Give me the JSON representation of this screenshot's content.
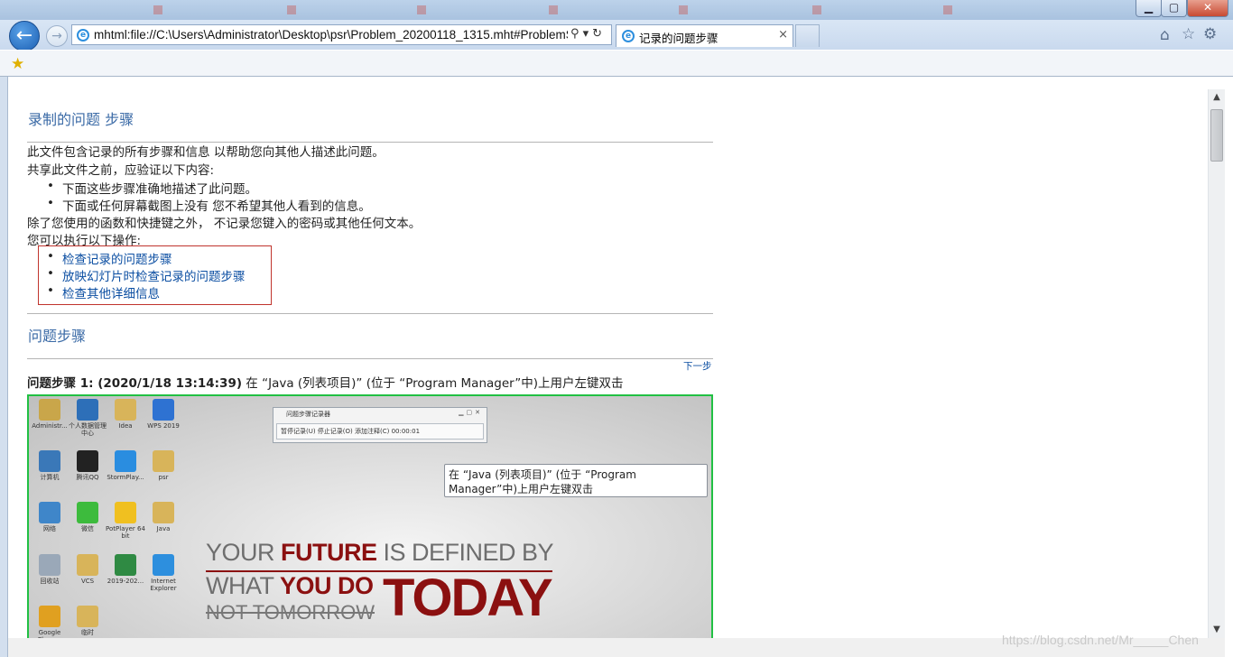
{
  "browser": {
    "url": "mhtml:file://C:\\Users\\Administrator\\Desktop\\psr\\Problem_20200118_1315.mht#ProblemS",
    "tab_title": "记录的问题步骤",
    "tab_close": "×"
  },
  "page": {
    "heading": "录制的问题  步骤",
    "intro_lines": [
      "此文件包含记录的所有步骤和信息 以帮助您向其他人描述此问题。",
      "共享此文件之前，应验证以下内容:"
    ],
    "verify_items": [
      "下面这些步骤准确地描述了此问题。",
      "下面或任何屏幕截图上没有  您不希望其他人看到的信息。"
    ],
    "note_line": "除了您使用的函数和快捷键之外，  不记录您键入的密码或其他任何文本。",
    "actions_intro": "您可以执行以下操作:",
    "action_links": [
      "检查记录的问题步骤",
      "放映幻灯片时检查记录的问题步骤",
      "检查其他详细信息"
    ],
    "steps_heading": "问题步骤",
    "next_link": "下一步",
    "step1": {
      "label": "问题步骤  1: (2020/1/18 13:14:39)",
      "desc": " 在 “Java (列表项目)” (位于 “Program Manager”中)上用户左键双击"
    }
  },
  "screenshot": {
    "desktop_icons": [
      {
        "label": "Administr...",
        "color": "#c9a64a"
      },
      {
        "label": "个人数据管理中心",
        "color": "#2d6fb8"
      },
      {
        "label": "Idea",
        "color": "#d8b45a"
      },
      {
        "label": "WPS 2019",
        "color": "#2e72d2"
      },
      {
        "label": "计算机",
        "color": "#3a78b8"
      },
      {
        "label": "腾讯QQ",
        "color": "#222222"
      },
      {
        "label": "StormPlay...",
        "color": "#2a8de0"
      },
      {
        "label": "psr",
        "color": "#d8b45a"
      },
      {
        "label": "网络",
        "color": "#3f86c9"
      },
      {
        "label": "微信",
        "color": "#3dbb3d"
      },
      {
        "label": "PotPlayer 64 bit",
        "color": "#f0c020"
      },
      {
        "label": "Java",
        "color": "#d8b45a"
      },
      {
        "label": "回收站",
        "color": "#9aa8b8"
      },
      {
        "label": "VCS",
        "color": "#d8b45a"
      },
      {
        "label": "2019-202...",
        "color": "#2f8a43"
      },
      {
        "label": "Internet Explorer",
        "color": "#2d8fde"
      },
      {
        "label": "Google Chrome",
        "color": "#e0a020"
      },
      {
        "label": "临时",
        "color": "#d8b45a"
      }
    ],
    "recorder_title": "问题步骤记录器",
    "recorder_buttons": "暂停记录(U)   停止记录(O)   添加注释(C)    00:00:01",
    "tooltip": "在 “Java (列表项目)” (位于 “Program Manager”中)上用户左键双击",
    "slogan_l1_a": "YOUR ",
    "slogan_l1_b": "FUTURE",
    "slogan_l1_c": " IS DEFINED BY",
    "slogan_l2_a": "WHAT ",
    "slogan_l2_b": "YOU DO",
    "slogan_l3": "NOT TOMORROW",
    "slogan_big": "TODAY"
  },
  "watermark": "https://blog.csdn.net/Mr_____Chen"
}
